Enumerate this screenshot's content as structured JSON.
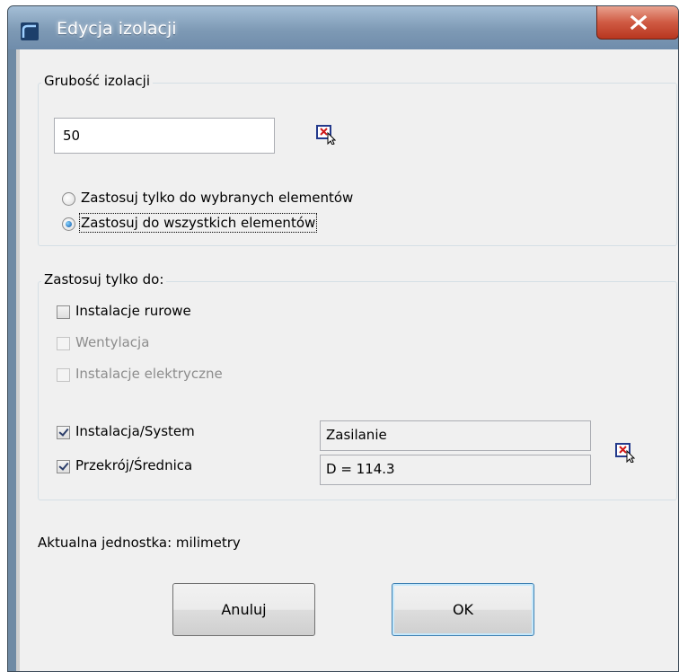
{
  "window": {
    "title": "Edycja izolacji"
  },
  "thickness_group": {
    "legend": "Grubość izolacji",
    "value": "50",
    "radio_selected": "Zastosuj tylko do wybranych elementów",
    "radio_all": "Zastosuj do wszystkich elementów",
    "selected_option": "all"
  },
  "apply_group": {
    "legend": "Zastosuj tylko do:",
    "pipes": {
      "label": "Instalacje rurowe",
      "checked": false,
      "enabled": true
    },
    "ventilation": {
      "label": "Wentylacja",
      "checked": false,
      "enabled": false
    },
    "electrical": {
      "label": "Instalacje elektryczne",
      "checked": false,
      "enabled": false
    },
    "system": {
      "label": "Instalacja/System",
      "checked": true,
      "value": "Zasilanie"
    },
    "section": {
      "label": "Przekrój/Średnica",
      "checked": true,
      "value": "D = 114.3"
    }
  },
  "unit_text": "Aktualna jednostka: milimetry",
  "buttons": {
    "cancel": "Anuluj",
    "ok": "OK"
  },
  "icons": {
    "app": "app-icon",
    "close": "close-icon",
    "pick": "pick-from-drawing-icon"
  }
}
